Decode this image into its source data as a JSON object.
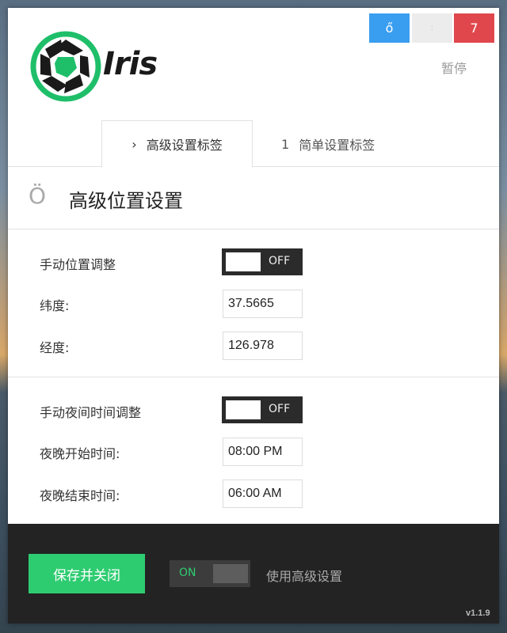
{
  "window": {
    "controls": {
      "minimize": "ő",
      "maximize": "ː",
      "close": "7"
    },
    "pause_label": "暂停"
  },
  "logo": {
    "text": "Iris",
    "icon": "aperture-icon",
    "color": "#1fbf6a"
  },
  "tabs": [
    {
      "glyph": "›",
      "label": "高级设置标签",
      "active": true
    },
    {
      "glyph": "1",
      "label": "简单设置标签",
      "active": false
    }
  ],
  "section": {
    "icon": "Ö",
    "title": "高级位置设置"
  },
  "location": {
    "manual_label": "手动位置调整",
    "manual_toggle": "OFF",
    "latitude_label": "纬度:",
    "latitude_value": "37.5665",
    "longitude_label": "经度:",
    "longitude_value": "126.978"
  },
  "night": {
    "manual_label": "手动夜间时间调整",
    "manual_toggle": "OFF",
    "start_label": "夜晚开始时间:",
    "start_value": "08:00 PM",
    "end_label": "夜晚结束时间:",
    "end_value": "06:00 AM"
  },
  "footer": {
    "save_label": "保存并关闭",
    "advanced_toggle": "ON",
    "advanced_label": "使用高级设置",
    "version": "v1.1.9"
  },
  "colors": {
    "accent": "#2ecc71",
    "close": "#e0474c",
    "minimize": "#3a9ef0",
    "footer_bg": "#232323"
  }
}
